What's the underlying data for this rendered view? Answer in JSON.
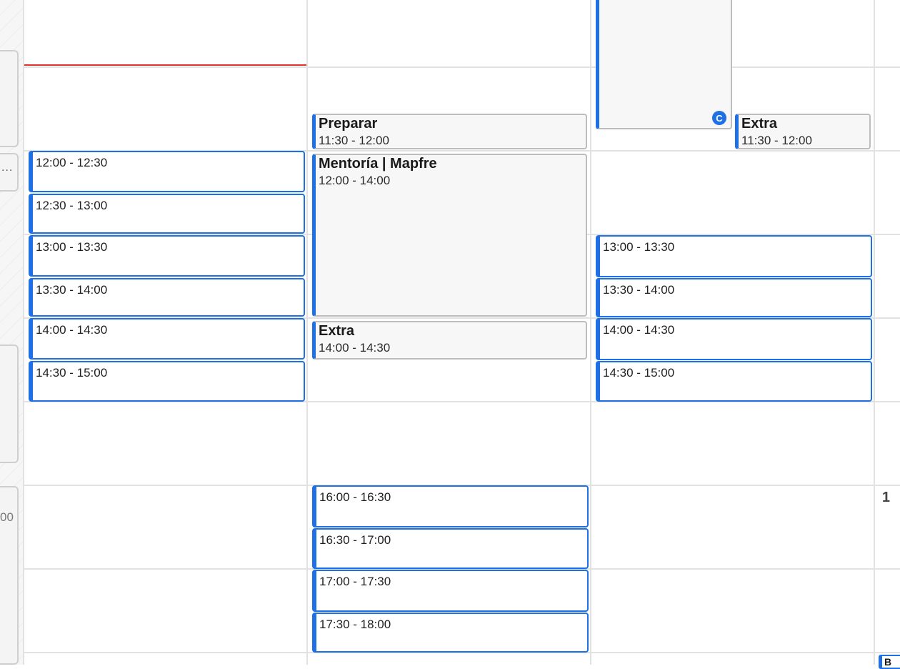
{
  "gutter": {
    "more_label": "...",
    "day_number": "1",
    "time_fragment": "00"
  },
  "columns": [
    {
      "slots": [
        "12:00 - 12:30",
        "12:30 - 13:00",
        "13:00 - 13:30",
        "13:30 - 14:00",
        "14:00 - 14:30",
        "14:30 - 15:00"
      ]
    },
    {
      "events": [
        {
          "title": "Preparar",
          "time": "11:30 - 12:00"
        },
        {
          "title": "Mentoría | Mapfre",
          "time": "12:00 - 14:00"
        },
        {
          "title": "Extra",
          "time": "14:00 - 14:30"
        }
      ],
      "slots": [
        "16:00 - 16:30",
        "16:30 - 17:00",
        "17:00 - 17:30",
        "17:30 - 18:00"
      ]
    },
    {
      "events": [
        {
          "title": "Extra",
          "time": "11:30 - 12:00"
        }
      ],
      "badge_icon": "calendly-icon",
      "slots": [
        "13:00 - 13:30",
        "13:30 - 14:00",
        "14:00 - 14:30",
        "14:30 - 15:00"
      ]
    }
  ],
  "corner_label": "B",
  "colors": {
    "accent": "#1f6fe5",
    "now_line": "#e3312d",
    "grid": "#e2e2e2",
    "event_bg": "#f7f7f7"
  }
}
